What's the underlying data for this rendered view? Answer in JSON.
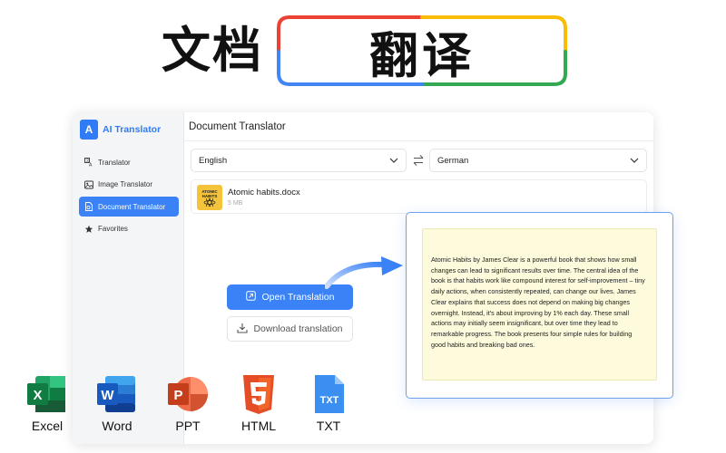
{
  "banner": {
    "left_text": "文档",
    "right_text": "翻译"
  },
  "app": {
    "logo_text": "AI Translator",
    "sidebar": {
      "items": [
        {
          "label": "Translator",
          "icon": "translate-icon",
          "active": false
        },
        {
          "label": "Image Translator",
          "icon": "image-icon",
          "active": false
        },
        {
          "label": "Document Translator",
          "icon": "document-icon",
          "active": true
        },
        {
          "label": "Favorites",
          "icon": "star-icon",
          "active": false
        }
      ]
    },
    "main": {
      "title": "Document Translator",
      "source_language": "English",
      "target_language": "German",
      "file": {
        "thumb_line1": "ATOMIC",
        "thumb_line2": "HABITS",
        "name": "Atomic habits.docx",
        "size": "5 MB"
      },
      "open_button": "Open Translation",
      "download_button": "Download translation"
    }
  },
  "preview": {
    "text": "Atomic Habits by James Clear is a powerful book that shows how small changes can lead to significant results over time. The central idea of the book is that habits work like compound interest for self-improvement – tiny daily actions, when consistently repeated, can change our lives. James Clear explains that success does not depend on making big changes overnight. Instead, it's about improving by 1% each day. These small actions may initially seem insignificant, but over time they lead to remarkable progress. The book presents four simple rules for building good habits and breaking bad ones."
  },
  "formats": [
    {
      "label": "Excel",
      "icon": "excel-icon",
      "color": "#1d7044"
    },
    {
      "label": "Word",
      "icon": "word-icon",
      "color": "#2b5cb8"
    },
    {
      "label": "PPT",
      "icon": "powerpoint-icon",
      "color": "#d24726"
    },
    {
      "label": "HTML",
      "icon": "html5-icon",
      "color": "#e5532d"
    },
    {
      "label": "TXT",
      "icon": "txt-file-icon",
      "color": "#3a8ff0"
    }
  ],
  "colors": {
    "accent": "#3b82f6",
    "frame_red": "#ea4335",
    "frame_yellow": "#fbbc05",
    "frame_green": "#34a853",
    "frame_blue": "#4285f4",
    "preview_bg": "#fdfbdc"
  }
}
